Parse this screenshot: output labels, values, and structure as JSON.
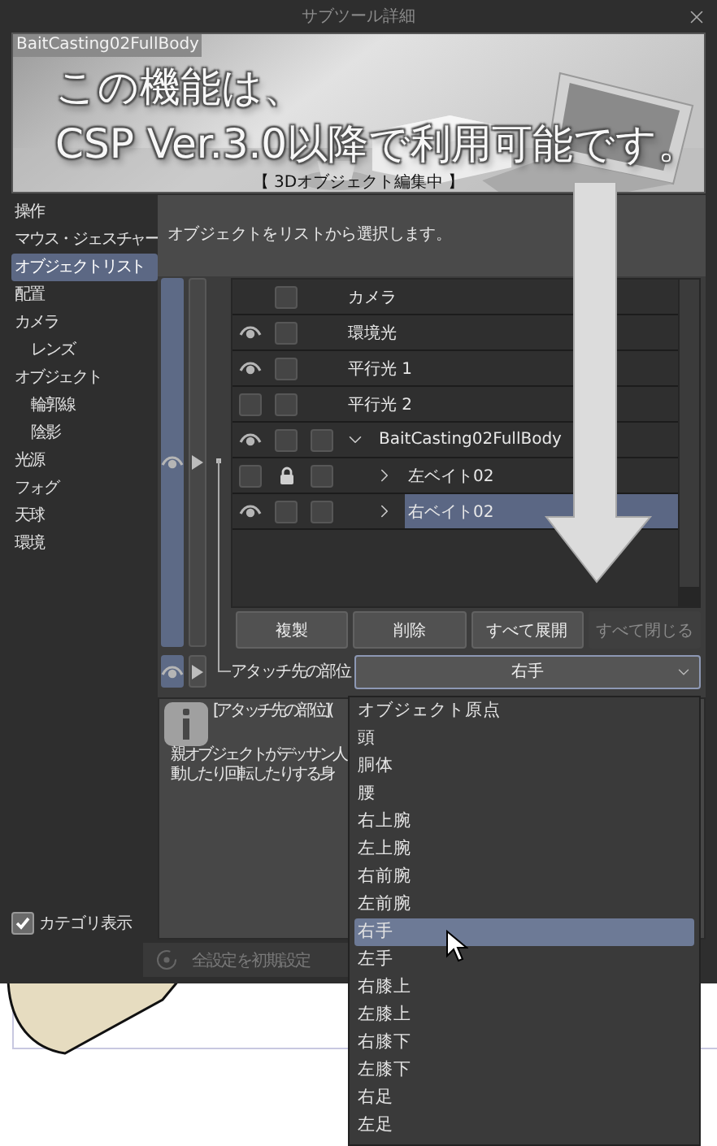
{
  "window": {
    "title": "サブツール詳細"
  },
  "preview": {
    "object_name": "BaitCasting02FullBody",
    "notice_lines": [
      "この機能は、",
      "CSP Ver.3.0以降で利用可能です。"
    ],
    "status": "【 3Dオブジェクト編集中 】"
  },
  "sidebar": {
    "items": [
      {
        "label": "操作",
        "selected": false
      },
      {
        "label": "マウス・ジェスチャー",
        "selected": false
      },
      {
        "label": "オブジェクトリスト",
        "selected": true
      },
      {
        "label": "配置",
        "selected": false
      },
      {
        "label": "カメラ",
        "selected": false,
        "children": [
          {
            "label": "レンズ",
            "selected": false
          }
        ]
      },
      {
        "label": "オブジェクト",
        "selected": false,
        "children": [
          {
            "label": "輪郭線",
            "selected": false
          },
          {
            "label": "陰影",
            "selected": false
          }
        ]
      },
      {
        "label": "光源",
        "selected": false
      },
      {
        "label": "フォグ",
        "selected": false
      },
      {
        "label": "天球",
        "selected": false
      },
      {
        "label": "環境",
        "selected": false
      }
    ],
    "category_display": {
      "label": "カテゴリ表示",
      "checked": true
    }
  },
  "description": "オブジェクトをリストから選択します。",
  "object_list": {
    "rows": [
      {
        "kind": "camera",
        "name": "カメラ",
        "locked": false,
        "selected": false
      },
      {
        "kind": "light",
        "name": "環境光",
        "visible": true,
        "locked": false,
        "selected": false
      },
      {
        "kind": "light",
        "name": "平行光 1",
        "visible": true,
        "locked": false,
        "selected": false
      },
      {
        "kind": "light",
        "name": "平行光 2",
        "visible": false,
        "locked": false,
        "selected": false
      },
      {
        "kind": "model",
        "name": "BaitCasting02FullBody",
        "visible": true,
        "locked": false,
        "checked": false,
        "expanded": true,
        "selected": false,
        "children": [
          {
            "kind": "part",
            "name": "左ベイト02",
            "visible": false,
            "locked": true,
            "checked": false,
            "expanded": false,
            "selected": false
          },
          {
            "kind": "part",
            "name": "右ベイト02",
            "visible": true,
            "locked": false,
            "checked": false,
            "expanded": false,
            "selected": true
          }
        ]
      }
    ]
  },
  "buttons": [
    {
      "label": "複製",
      "disabled": false
    },
    {
      "label": "削除",
      "disabled": false
    },
    {
      "label": "すべて展開",
      "disabled": false
    },
    {
      "label": "すべて閉じる",
      "disabled": true
    }
  ],
  "attach": {
    "label": "アタッチ先の部位",
    "value": "右手",
    "expanded": true,
    "options": [
      {
        "label": "オブジェクト原点",
        "selected": false
      },
      {
        "label": "頭",
        "selected": false
      },
      {
        "label": "胴体",
        "selected": false
      },
      {
        "label": "腰",
        "selected": false
      },
      {
        "label": "右上腕",
        "selected": false
      },
      {
        "label": "左上腕",
        "selected": false
      },
      {
        "label": "右前腕",
        "selected": false
      },
      {
        "label": "左前腕",
        "selected": false
      },
      {
        "label": "右手",
        "selected": true
      },
      {
        "label": "左手",
        "selected": false
      },
      {
        "label": "右膝上",
        "selected": false
      },
      {
        "label": "左膝上",
        "selected": false
      },
      {
        "label": "右膝下",
        "selected": false
      },
      {
        "label": "左膝下",
        "selected": false
      },
      {
        "label": "右足",
        "selected": false
      },
      {
        "label": "左足",
        "selected": false
      }
    ]
  },
  "info": {
    "title": "[アタッチ先の部位](",
    "lines": [
      "親オブジェクトがデッサン人",
      "動したり回転したりする身"
    ]
  },
  "footer": {
    "reset_label": "全設定を初期設定"
  }
}
